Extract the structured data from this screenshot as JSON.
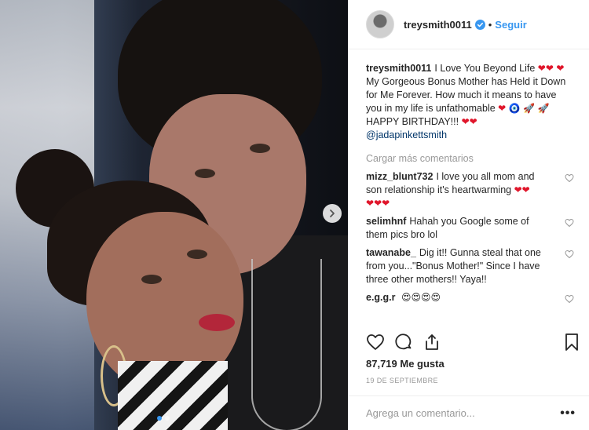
{
  "post": {
    "author": "treysmith0011",
    "verified": true,
    "separator": "•",
    "follow_label": "Seguir",
    "photo_alt": "Trey Smith and Jada Pinkett Smith"
  },
  "caption": {
    "username": "treysmith0011",
    "text_1": "I Love You Beyond Life",
    "text_2": "My Gorgeous Bonus Mother has Held it Down for Me Forever. How much it means to have you in my life is unfathomable",
    "text_3": "HAPPY BIRTHDAY!!!",
    "mention": "@jadapinkettsmith"
  },
  "load_more_label": "Cargar más comentarios",
  "comments": [
    {
      "username": "mizz_blunt732",
      "text": "I love you all mom and son relationship it's heartwarming"
    },
    {
      "username": "selimhnf",
      "text": "Hahah you Google some of them pics bro lol"
    },
    {
      "username": "tawanabe_",
      "text": "Dig it!! Gunna steal that one from you...\"Bonus Mother!\" Since I have three other mothers!! Yaya!!"
    },
    {
      "username": "e.g.g.r",
      "text": ""
    }
  ],
  "emojis": {
    "heart": "❤",
    "evil_eye": "🧿",
    "rocket": "🚀",
    "heart_eyes": "😍"
  },
  "likes_label": "87,719 Me gusta",
  "date_label": "19 DE SEPTIEMBRE",
  "comment_input": {
    "placeholder": "Agrega un comentario..."
  },
  "more_label": "•••",
  "colors": {
    "link": "#3897f0",
    "mention": "#003569",
    "heart": "#e0162b",
    "muted": "#999999"
  }
}
